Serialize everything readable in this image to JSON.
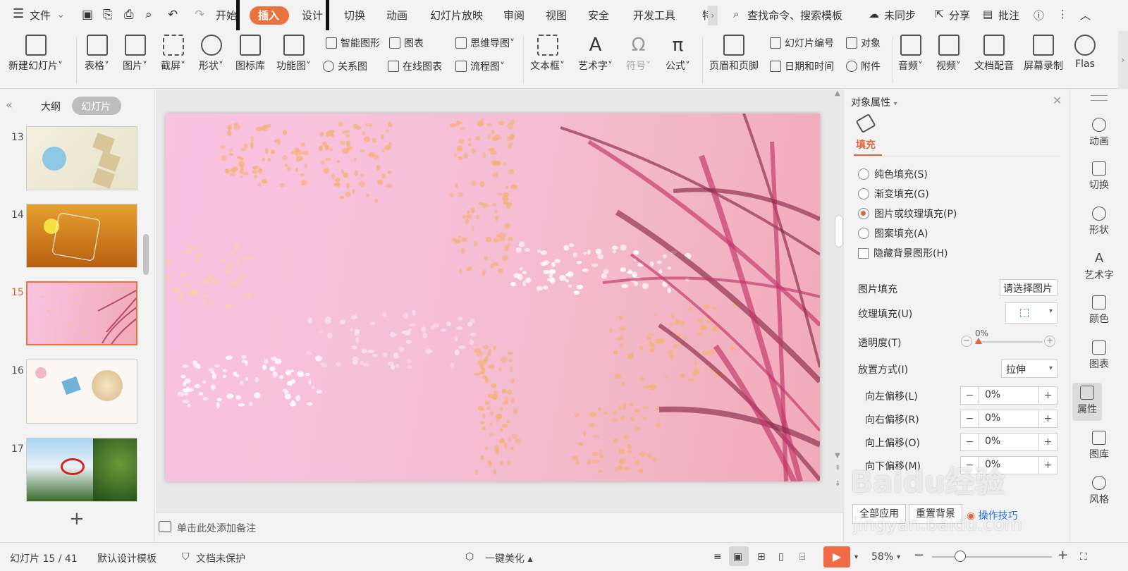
{
  "menubar": {
    "menu_icon": "hamburger-icon",
    "file": "文件",
    "tabs": [
      "开始",
      "插入",
      "设计",
      "切换",
      "动画",
      "幻灯片放映",
      "审阅",
      "视图",
      "安全",
      "开发工具",
      "特"
    ],
    "active_tab": "插入",
    "search": "查找命令、搜索模板",
    "sync": "未同步",
    "share": "分享",
    "comment": "批注",
    "accent": "#e8733f"
  },
  "ribbon": {
    "new_slide": "新建幻灯片",
    "table": "表格",
    "picture": "图片",
    "screenshot": "截屏",
    "shape": "形状",
    "icon_lib": "图标库",
    "func_chart": "功能图",
    "smart_art": "智能图形",
    "chart": "图表",
    "relation": "关系图",
    "online_chart": "在线图表",
    "mindmap": "思维导图",
    "flowchart": "流程图",
    "textbox": "文本框",
    "wordart": "艺术字",
    "symbol": "符号",
    "formula": "公式",
    "header_footer": "页眉和页脚",
    "slide_number": "幻灯片编号",
    "object": "对象",
    "date_time": "日期和时间",
    "attachment": "附件",
    "audio": "音频",
    "video": "视频",
    "narration": "文档配音",
    "screen_record": "屏幕录制",
    "flash": "Flas"
  },
  "leftpane": {
    "tab_outline": "大纲",
    "tab_slides": "幻灯片",
    "slides": [
      {
        "num": "13"
      },
      {
        "num": "14"
      },
      {
        "num": "15"
      },
      {
        "num": "16"
      },
      {
        "num": "17"
      }
    ],
    "selected": "15",
    "add": "+"
  },
  "notes": {
    "placeholder": "单击此处添加备注"
  },
  "props": {
    "title": "对象属性",
    "section": "填充",
    "fill_options": [
      "纯色填充(S)",
      "渐变填充(G)",
      "图片或纹理填充(P)",
      "图案填充(A)"
    ],
    "selected_fill": "图片或纹理填充(P)",
    "hide_bg": "隐藏背景图形(H)",
    "pic_fill_label": "图片填充",
    "pic_fill_value": "请选择图片",
    "texture_label": "纹理填充(U)",
    "transparency_label": "透明度(T)",
    "transparency_value": "0%",
    "placement_label": "放置方式(I)",
    "placement_value": "拉伸",
    "offsets": [
      {
        "label": "向左偏移(L)",
        "value": "0%"
      },
      {
        "label": "向右偏移(R)",
        "value": "0%"
      },
      {
        "label": "向上偏移(O)",
        "value": "0%"
      },
      {
        "label": "向下偏移(M)",
        "value": "0%"
      }
    ],
    "apply_all": "全部应用",
    "reset_bg": "重置背景",
    "tips": "操作技巧"
  },
  "righttools": [
    "动画",
    "切换",
    "形状",
    "艺术字",
    "颜色",
    "图表",
    "属性",
    "图库",
    "风格"
  ],
  "status": {
    "slide_info": "幻灯片 15 / 41",
    "template": "默认设计模板",
    "protect": "文档未保护",
    "beautify": "一键美化",
    "zoom": "58%"
  },
  "watermark": {
    "text": "Baidu经验",
    "url": "jingyan.baidu.com"
  }
}
